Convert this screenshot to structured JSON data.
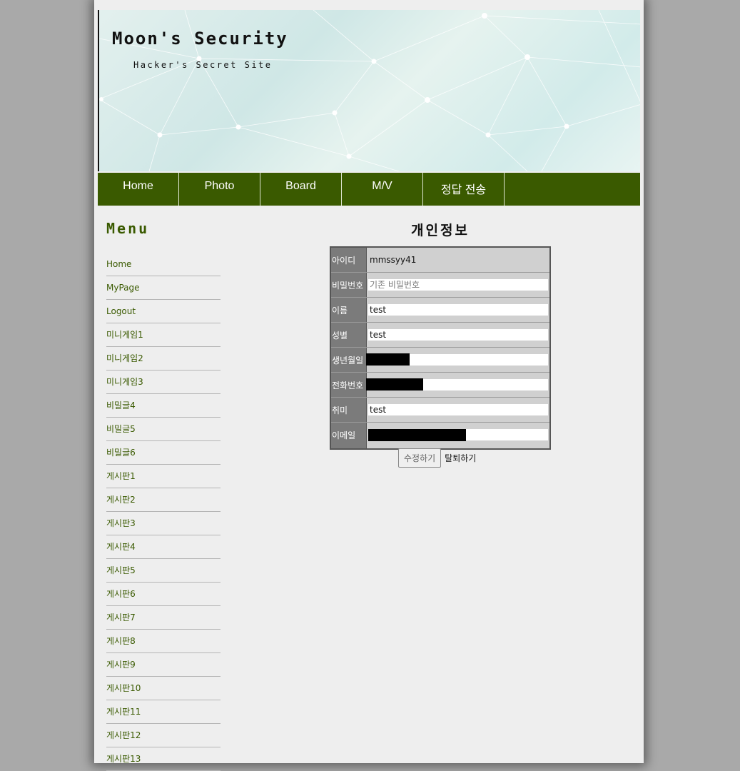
{
  "header": {
    "title": "Moon's Security",
    "subtitle": "Hacker's Secret Site"
  },
  "nav": {
    "items": [
      "Home",
      "Photo",
      "Board",
      "M/V",
      "정답 전송"
    ]
  },
  "sidebar": {
    "title": "Menu",
    "items": [
      "Home",
      "MyPage",
      "Logout",
      "미니게임1",
      "미니게임2",
      "미니게임3",
      "비밀글4",
      "비밀글5",
      "비밀글6",
      "게시판1",
      "게시판2",
      "게시판3",
      "게시판4",
      "게시판5",
      "게시판6",
      "게시판7",
      "게시판8",
      "게시판9",
      "게시판10",
      "게시판11",
      "게시판12",
      "게시판13"
    ]
  },
  "main": {
    "title": "개인정보",
    "form": {
      "id_label": "아이디",
      "id_value": "mmssyy41",
      "password_label": "비밀번호",
      "password_placeholder": "기존 비밀번호",
      "name_label": "이름",
      "name_value": "test",
      "gender_label": "성별",
      "gender_value": "test",
      "birth_label": "생년월일",
      "phone_label": "전화번호",
      "hobby_label": "취미",
      "hobby_value": "test",
      "email_label": "이메일"
    },
    "edit_button": "수정하기",
    "withdraw_link": "탈퇴하기"
  },
  "colors": {
    "nav_bg": "#3a5a00",
    "page_bg": "#eeeeee",
    "outer_bg": "#a9a9a9",
    "label_bg": "#7b7b7b"
  }
}
